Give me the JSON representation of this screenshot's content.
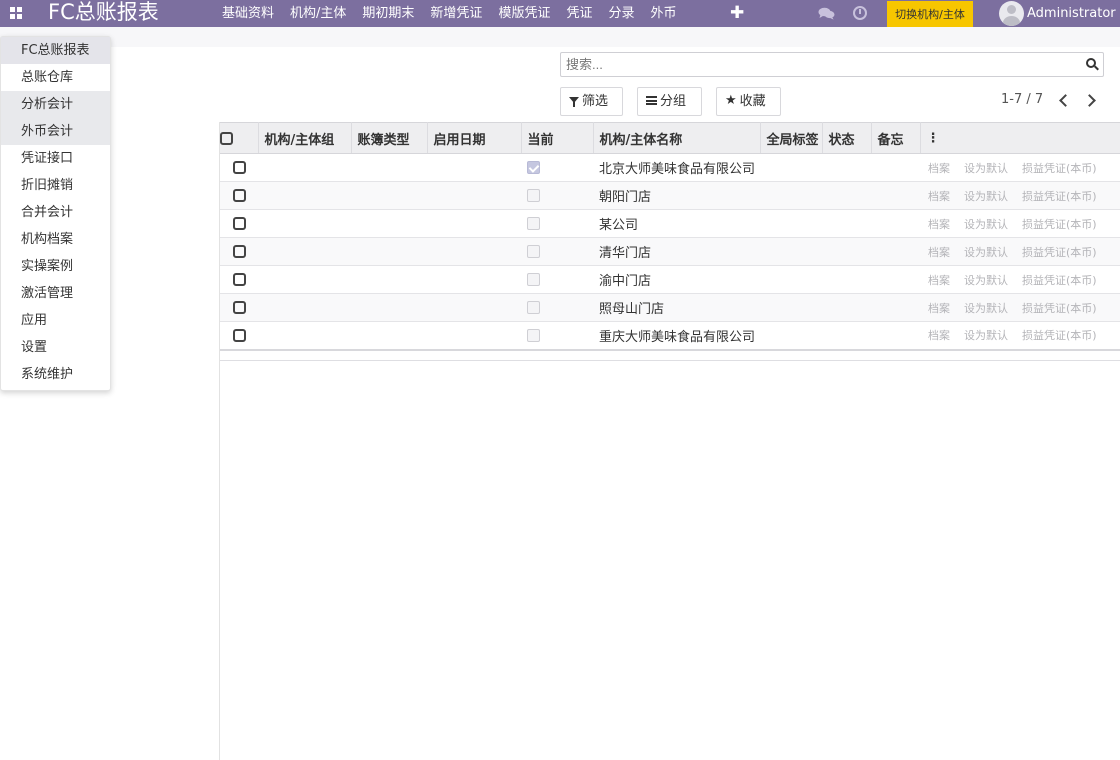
{
  "navbar": {
    "brand": "FC总账报表",
    "menu": [
      "基础资料",
      "机构/主体",
      "期初期末",
      "新增凭证",
      "模版凭证",
      "凭证",
      "分录",
      "外币"
    ],
    "plus": "✚",
    "switch_button": "切换机构/主体",
    "user_name": "Administrator",
    "bg_color": "#7c6f9f",
    "switch_color": "#f7c600"
  },
  "app_dropdown": {
    "items": [
      "FC总账报表",
      "总账仓库",
      "分析会计",
      "外币会计",
      "凭证接口",
      "折旧摊销",
      "合并会计",
      "机构档案",
      "实操案例",
      "激活管理",
      "应用",
      "设置",
      "系统维护"
    ]
  },
  "search": {
    "placeholder": "搜索..."
  },
  "controls": {
    "filter": "筛选",
    "group": "分组",
    "favorites": "收藏"
  },
  "pager": {
    "value": "1-7 / 7"
  },
  "table": {
    "columns": [
      "机构/主体组",
      "账簿类型",
      "启用日期",
      "当前",
      "机构/主体名称",
      "全局标签",
      "状态",
      "备忘"
    ],
    "row_actions": [
      "档案",
      "设为默认",
      "损益凭证(本币)"
    ],
    "rows": [
      {
        "name": "北京大师美味食品有限公司",
        "current": true
      },
      {
        "name": "朝阳门店",
        "current": false
      },
      {
        "name": "某公司",
        "current": false
      },
      {
        "name": "清华门店",
        "current": false
      },
      {
        "name": "渝中门店",
        "current": false
      },
      {
        "name": "照母山门店",
        "current": false
      },
      {
        "name": "重庆大师美味食品有限公司",
        "current": false
      }
    ]
  }
}
